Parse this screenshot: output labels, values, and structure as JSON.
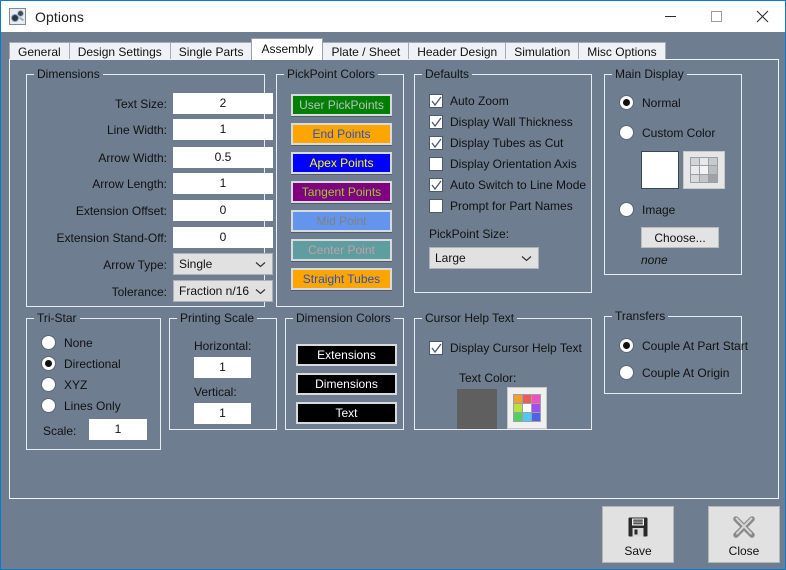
{
  "window": {
    "title": "Options",
    "icon": "app-gears-icon",
    "minimize": "minimize-icon",
    "maximize": "maximize-icon",
    "close": "close-icon"
  },
  "tabs": [
    {
      "label": "General",
      "active": false
    },
    {
      "label": "Design Settings",
      "active": false
    },
    {
      "label": "Single Parts",
      "active": false
    },
    {
      "label": "Assembly",
      "active": true
    },
    {
      "label": "Plate / Sheet",
      "active": false
    },
    {
      "label": "Header Design",
      "active": false
    },
    {
      "label": "Simulation",
      "active": false
    },
    {
      "label": "Misc Options",
      "active": false
    }
  ],
  "dimensions": {
    "caption": "Dimensions",
    "fields": [
      {
        "label": "Text Size:",
        "value": "2"
      },
      {
        "label": "Line Width:",
        "value": "1"
      },
      {
        "label": "Arrow Width:",
        "value": "0.5"
      },
      {
        "label": "Arrow Length:",
        "value": "1"
      },
      {
        "label": "Extension Offset:",
        "value": "0"
      },
      {
        "label": "Extension Stand-Off:",
        "value": "0"
      }
    ],
    "combos": [
      {
        "label": "Arrow Type:",
        "value": "Single"
      },
      {
        "label": "Tolerance:",
        "value": "Fraction n/16"
      }
    ]
  },
  "pickpoint_colors": {
    "caption": "PickPoint Colors",
    "buttons": [
      {
        "label": "User PickPoints",
        "bg": "#008000",
        "fg": "#b9c0c6"
      },
      {
        "label": "End Points",
        "bg": "#ffa500",
        "fg": "#2a52be"
      },
      {
        "label": "Apex Points",
        "bg": "#0000ff",
        "fg": "#ffff00"
      },
      {
        "label": "Tangent Points",
        "bg": "#800080",
        "fg": "#9acd32"
      },
      {
        "label": "Mid Point",
        "bg": "#6495ed",
        "fg": "#808080"
      },
      {
        "label": "Center Point",
        "bg": "#5f9ea0",
        "fg": "#c0a0a8"
      },
      {
        "label": "Straight Tubes",
        "bg": "#ffa500",
        "fg": "#2a52be"
      }
    ]
  },
  "defaults": {
    "caption": "Defaults",
    "checkboxes": [
      {
        "label": "Auto Zoom",
        "checked": true
      },
      {
        "label": "Display Wall Thickness",
        "checked": true
      },
      {
        "label": "Display Tubes as Cut",
        "checked": true
      },
      {
        "label": "Display Orientation Axis",
        "checked": false
      },
      {
        "label": "Auto Switch to Line Mode",
        "checked": true
      },
      {
        "label": "Prompt for Part Names",
        "checked": false
      }
    ],
    "pickpoint_size_label": "PickPoint Size:",
    "pickpoint_size_value": "Large"
  },
  "main_display": {
    "caption": "Main Display",
    "radios": [
      {
        "label": "Normal",
        "selected": true
      },
      {
        "label": "Custom Color",
        "selected": false
      },
      {
        "label": "Image",
        "selected": false
      }
    ],
    "custom_color_swatch": "#ffffff",
    "palette_icon": "color-palette-grid-icon",
    "palette_colors": [
      "#d2d4d8",
      "#e6e8ea",
      "#c6c9cd",
      "#e8eaec",
      "#f2f3f4",
      "#b9bcc0",
      "#d8dadd",
      "#c2c5c9",
      "#9fa3a8"
    ],
    "choose_label": "Choose...",
    "image_value": "none"
  },
  "tristar": {
    "caption": "Tri-Star",
    "radios": [
      {
        "label": "None",
        "selected": false
      },
      {
        "label": "Directional",
        "selected": true
      },
      {
        "label": "XYZ",
        "selected": false
      },
      {
        "label": "Lines Only",
        "selected": false
      }
    ],
    "scale_label": "Scale:",
    "scale_value": "1"
  },
  "printing_scale": {
    "caption": "Printing Scale",
    "horizontal_label": "Horizontal:",
    "horizontal_value": "1",
    "vertical_label": "Vertical:",
    "vertical_value": "1"
  },
  "dimension_colors": {
    "caption": "Dimension Colors",
    "buttons": [
      {
        "label": "Extensions",
        "bg": "#000000",
        "fg": "#ffffff"
      },
      {
        "label": "Dimensions",
        "bg": "#000000",
        "fg": "#ffffff"
      },
      {
        "label": "Text",
        "bg": "#000000",
        "fg": "#ffffff"
      }
    ]
  },
  "cursor_help": {
    "caption": "Cursor Help Text",
    "checkbox_label": "Display Cursor Help Text",
    "checkbox_checked": true,
    "text_color_label": "Text Color:",
    "swatch": "#5f5f5f",
    "palette_icon": "color-palette-grid-icon",
    "palette_colors": [
      "#f0a030",
      "#f05a5a",
      "#f050c0",
      "#b8e040",
      "#ffffff",
      "#a050e8",
      "#50d060",
      "#50c8f0",
      "#5060e8"
    ]
  },
  "transfers": {
    "caption": "Transfers",
    "radios": [
      {
        "label": "Couple At Part Start",
        "selected": true
      },
      {
        "label": "Couple At Origin",
        "selected": false
      }
    ]
  },
  "footer": {
    "save_label": "Save",
    "save_icon": "floppy-disk-save-icon",
    "close_label": "Close",
    "close_icon": "x-close-icon"
  }
}
